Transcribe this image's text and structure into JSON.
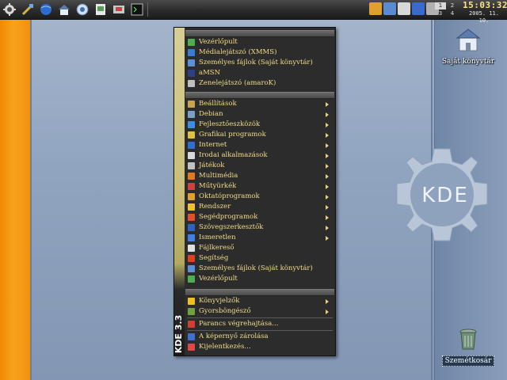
{
  "desktop": {
    "logo_text": "KDE",
    "icons": [
      {
        "name": "home-folder",
        "label": "Saját könyvtár"
      },
      {
        "name": "trash",
        "label": "Szemétkosár"
      }
    ]
  },
  "taskbar": {
    "launchers": [
      "kde-menu-icon",
      "settings-icon",
      "browser-icon",
      "home-icon",
      "network-icon",
      "help-icon",
      "system-icon",
      "terminal-icon"
    ],
    "pager": [
      "1",
      "2",
      "3",
      "4"
    ],
    "clock_time": "15:03:32",
    "clock_date": "2005. 11. 10."
  },
  "kmenu": {
    "side_label": "KDE 3.3",
    "recent": [
      {
        "label": "Vezérlőpult",
        "icon": "control-panel-icon",
        "color": "#4caf50"
      },
      {
        "label": "Médialejátszó (XMMS)",
        "icon": "media-player-icon",
        "color": "#3a7bd5"
      },
      {
        "label": "Személyes fájlok (Saját könyvtár)",
        "icon": "home-icon",
        "color": "#5b8fd6"
      },
      {
        "label": "aMSN",
        "icon": "amsn-icon",
        "color": "#2f3f88"
      },
      {
        "label": "Zenelejátszó (amaroK)",
        "icon": "amarok-icon",
        "color": "#bfbfbf"
      }
    ],
    "apps": [
      {
        "label": "Beállítások",
        "icon": "settings-icon",
        "color": "#c9a44c",
        "submenu": true
      },
      {
        "label": "Debian",
        "icon": "debian-icon",
        "color": "#7aa0c8",
        "submenu": true
      },
      {
        "label": "Fejlesztőeszközök",
        "icon": "development-icon",
        "color": "#3b8fe0",
        "submenu": true
      },
      {
        "label": "Grafikai programok",
        "icon": "graphics-icon",
        "color": "#e0c040",
        "submenu": true
      },
      {
        "label": "Internet",
        "icon": "internet-icon",
        "color": "#2f6fd0",
        "submenu": true
      },
      {
        "label": "Irodai alkalmazások",
        "icon": "office-icon",
        "color": "#d9d9d9",
        "submenu": true
      },
      {
        "label": "Játékok",
        "icon": "games-icon",
        "color": "#c0c0c0",
        "submenu": true
      },
      {
        "label": "Multimédia",
        "icon": "multimedia-icon",
        "color": "#e07a20",
        "submenu": true
      },
      {
        "label": "Műtyürkék",
        "icon": "toys-icon",
        "color": "#d04040",
        "submenu": true
      },
      {
        "label": "Oktatóprogramok",
        "icon": "education-icon",
        "color": "#e0a030",
        "submenu": true
      },
      {
        "label": "Rendszer",
        "icon": "system-icon",
        "color": "#f0c030",
        "submenu": true
      },
      {
        "label": "Segédprogramok",
        "icon": "utilities-icon",
        "color": "#e05030",
        "submenu": true
      },
      {
        "label": "Szövegszerkesztők",
        "icon": "editors-icon",
        "color": "#3060c0",
        "submenu": true
      },
      {
        "label": "Ismeretlen",
        "icon": "unknown-icon",
        "color": "#4080e0",
        "submenu": true
      },
      {
        "label": "Fájlkereső",
        "icon": "find-files-icon",
        "color": "#e0e0e0",
        "submenu": false
      },
      {
        "label": "Segítség",
        "icon": "help-icon",
        "color": "#e04020",
        "submenu": false
      },
      {
        "label": "Személyes fájlok (Saját könyvtár)",
        "icon": "home-icon",
        "color": "#5b8fd6",
        "submenu": false
      },
      {
        "label": "Vezérlőpult",
        "icon": "control-panel-icon",
        "color": "#4caf50",
        "submenu": false
      }
    ],
    "actions": [
      {
        "label": "Könyvjelzők",
        "icon": "bookmarks-icon",
        "color": "#f0c020",
        "submenu": true
      },
      {
        "label": "Gyorsböngésző",
        "icon": "quick-browser-icon",
        "color": "#70a040",
        "submenu": true
      },
      {
        "label": "Parancs végrehajtása...",
        "icon": "run-command-icon",
        "color": "#d04030",
        "submenu": false
      },
      {
        "label": "A képernyő zárolása",
        "icon": "lock-screen-icon",
        "color": "#4070d0",
        "submenu": false
      },
      {
        "label": "Kijelentkezés...",
        "icon": "logout-icon",
        "color": "#e04848",
        "submenu": false
      }
    ]
  }
}
